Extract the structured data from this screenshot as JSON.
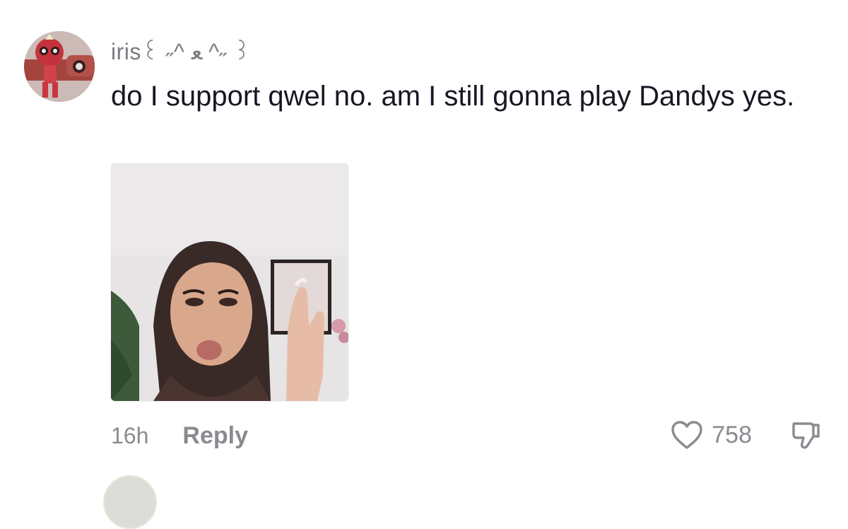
{
  "comment": {
    "username": "iris꒰ ˶^ ﻌ ^˶ ꒱",
    "text": "do I support qwel no. am I still gonna play Dandys yes.",
    "timestamp": "16h",
    "reply_label": "Reply",
    "like_count": "758",
    "liked": false
  },
  "icons": {
    "like": "heart-outline-icon",
    "dislike": "thumbs-down-icon"
  },
  "colors": {
    "text": "#161823",
    "muted": "#8a8b91",
    "username": "#7a7b80",
    "background": "#ffffff"
  }
}
